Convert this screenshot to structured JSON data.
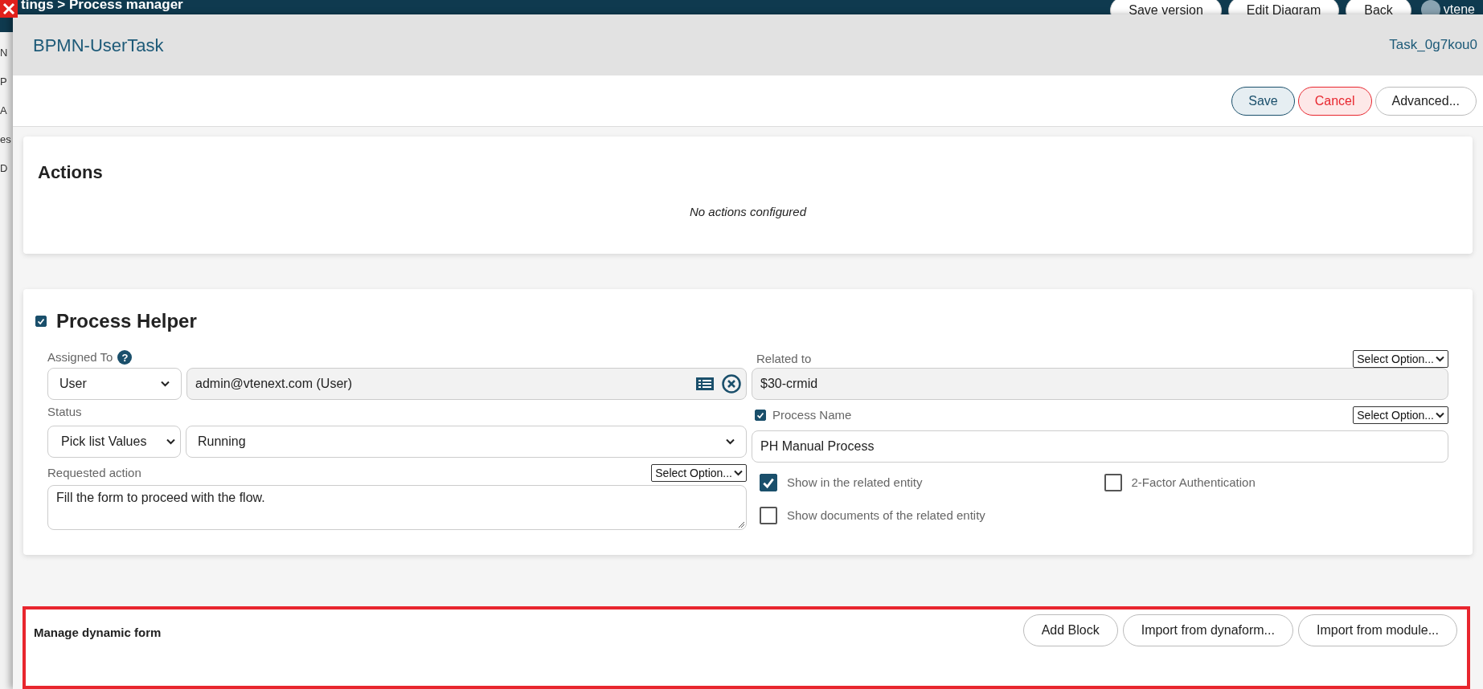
{
  "background": {
    "breadcrumb": "tings > Process manager",
    "buttons": [
      "Save version",
      "Edit Diagram",
      "Back"
    ],
    "user": "vtene",
    "side_labels": [
      "N",
      "P",
      "A",
      "es",
      "D"
    ]
  },
  "dialog": {
    "title": "BPMN-UserTask",
    "task_id": "Task_0g7kou0",
    "buttons": [
      {
        "label": "Save",
        "kind": "save"
      },
      {
        "label": "Cancel",
        "kind": "cancel"
      },
      {
        "label": "Advanced...",
        "kind": "plain"
      }
    ]
  },
  "actions": {
    "title": "Actions",
    "empty": "No actions configured"
  },
  "process_helper": {
    "enabled": true,
    "title": "Process Helper",
    "assigned_to": {
      "label": "Assigned To",
      "help": "?",
      "type": "User",
      "value": "admin@vtenext.com (User)"
    },
    "status": {
      "label": "Status",
      "source": "Pick list Values",
      "value": "Running"
    },
    "requested_action": {
      "label": "Requested action",
      "option": "Select Option...",
      "value": "Fill the form to proceed with the flow."
    },
    "related_to": {
      "label": "Related to",
      "option": "Select Option...",
      "value": "$30-crmid"
    },
    "process_name": {
      "label": "Process Name",
      "checked": true,
      "option": "Select Option...",
      "value": "PH Manual Process"
    },
    "options": [
      {
        "label": "Show in the related entity",
        "checked": true
      },
      {
        "label": "2-Factor Authentication",
        "checked": false
      },
      {
        "label": "Show documents of the related entity",
        "checked": false
      }
    ]
  },
  "dynamic_form": {
    "title": "Manage dynamic form",
    "buttons": [
      "Add Block",
      "Import from dynaform...",
      "Import from module..."
    ]
  }
}
